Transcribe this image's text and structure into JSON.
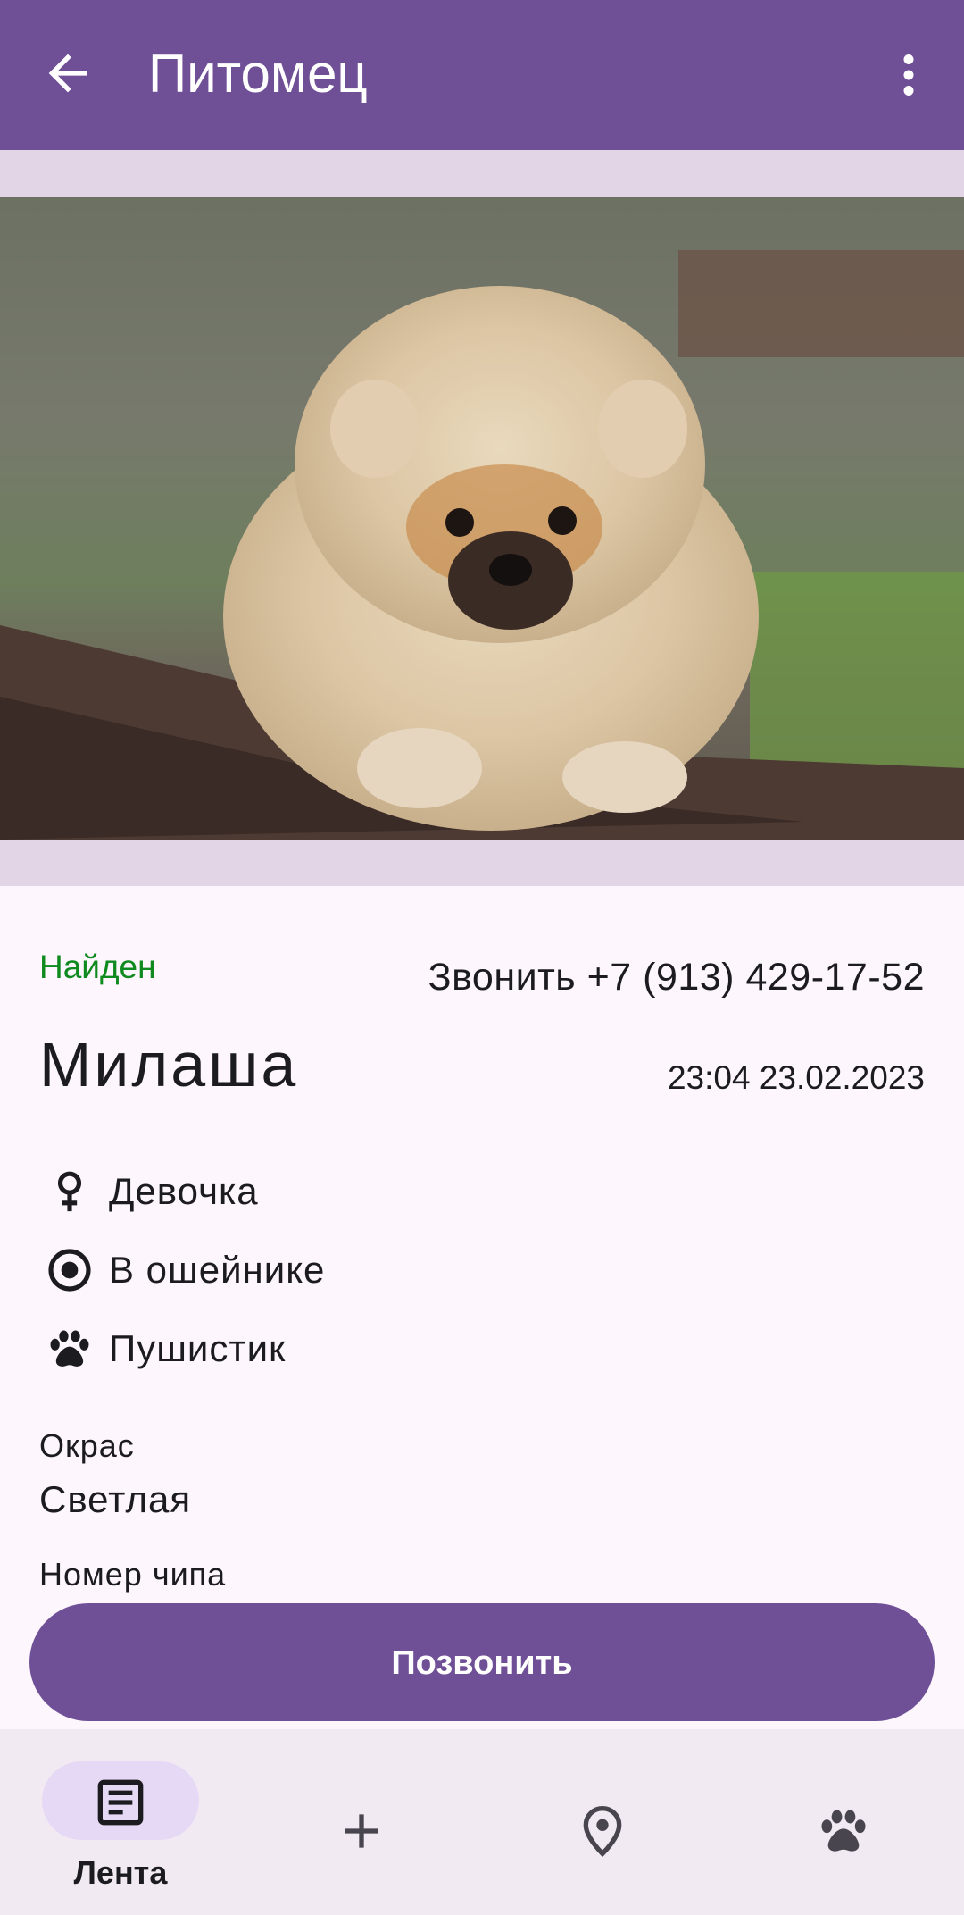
{
  "app_bar": {
    "title": "Питомец",
    "back_icon": "arrow-back-icon",
    "more_icon": "more-vertical-icon",
    "color": "#6f4f96"
  },
  "pet": {
    "status": "Найден",
    "status_color": "#0f8a1f",
    "call_text": "Звонить +7 (913) 429-17-52",
    "name": "Милаша",
    "date": "23:04 23.02.2023",
    "attributes": [
      {
        "icon": "female-icon",
        "label": "Девочка"
      },
      {
        "icon": "radio-collar-icon",
        "label": "В ошейнике"
      },
      {
        "icon": "paw-icon",
        "label": "Пушистик"
      }
    ],
    "fields": [
      {
        "label": "Окрас",
        "value": "Светлая"
      },
      {
        "label": "Номер чипа",
        "value": ""
      }
    ]
  },
  "call_button": {
    "label": "Позвонить"
  },
  "bottom_nav": {
    "items": [
      {
        "icon": "feed-icon",
        "label": "Лента",
        "active": true
      },
      {
        "icon": "add-icon",
        "label": ""
      },
      {
        "icon": "location-pin-icon",
        "label": ""
      },
      {
        "icon": "paw-icon",
        "label": ""
      }
    ]
  }
}
